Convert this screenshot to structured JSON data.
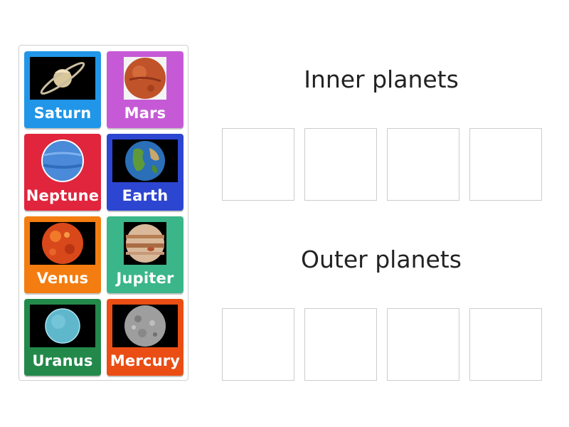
{
  "cards": [
    {
      "label": "Saturn",
      "color": "#2196e8",
      "icon": "saturn-icon"
    },
    {
      "label": "Mars",
      "color": "#c65ad6",
      "icon": "mars-icon"
    },
    {
      "label": "Neptune",
      "color": "#e0253d",
      "icon": "neptune-icon"
    },
    {
      "label": "Earth",
      "color": "#2d46d1",
      "icon": "earth-icon"
    },
    {
      "label": "Venus",
      "color": "#f37d10",
      "icon": "venus-icon"
    },
    {
      "label": "Jupiter",
      "color": "#3bb68b",
      "icon": "jupiter-icon"
    },
    {
      "label": "Uranus",
      "color": "#23894a",
      "icon": "uranus-icon"
    },
    {
      "label": "Mercury",
      "color": "#ea4e15",
      "icon": "mercury-icon"
    }
  ],
  "groups": [
    {
      "title": "Inner planets",
      "slot_count": 4
    },
    {
      "title": "Outer planets",
      "slot_count": 4
    }
  ]
}
